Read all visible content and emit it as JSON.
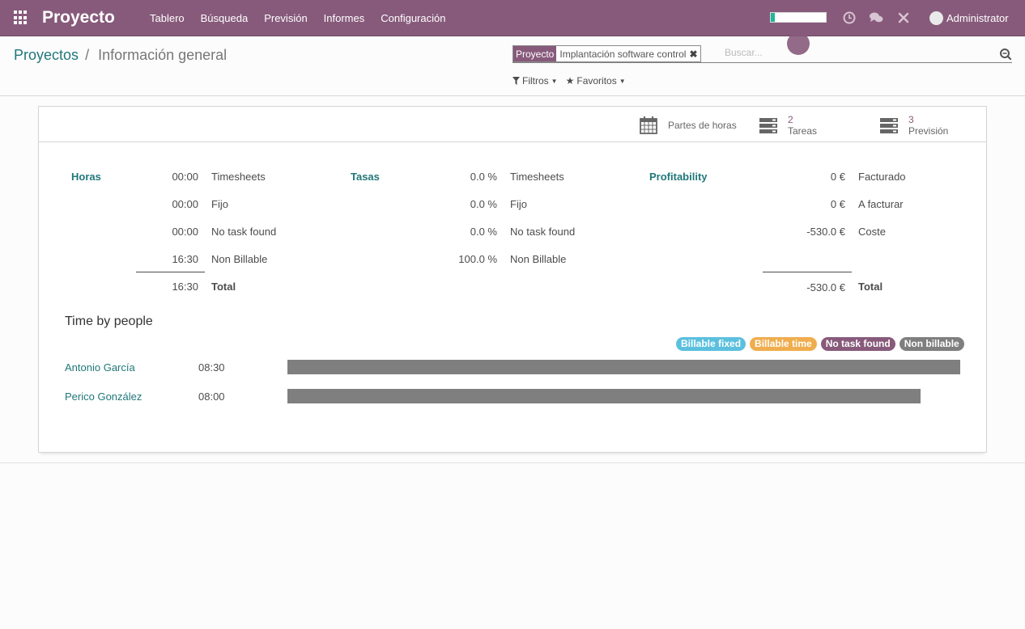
{
  "navbar": {
    "app_title": "Proyecto",
    "menu": [
      "Tablero",
      "Búsqueda",
      "Previsión",
      "Informes",
      "Configuración"
    ],
    "user": "Administrator",
    "progress_fraction": 0.07,
    "icons": [
      "apps-icon",
      "clock-icon",
      "chat-icon",
      "debug-icon",
      "avatar"
    ]
  },
  "breadcrumb": {
    "parent": "Proyectos",
    "separator": "/",
    "current": "Información general"
  },
  "search": {
    "facet_label": "Proyecto",
    "facet_value": "Implantación software control",
    "facet_remove": "✖",
    "placeholder": "Buscar..."
  },
  "filters": {
    "filters_label": "Filtros",
    "favorites_label": "Favoritos"
  },
  "stat_buttons": {
    "timesheets": {
      "label": "Partes de horas"
    },
    "tasks": {
      "value": "2",
      "label": "Tareas"
    },
    "forecast": {
      "value": "3",
      "label": "Previsión"
    }
  },
  "hours": {
    "title": "Horas",
    "rows": [
      {
        "value": "00:00",
        "label": "Timesheets"
      },
      {
        "value": "00:00",
        "label": "Fijo"
      },
      {
        "value": "00:00",
        "label": "No task found"
      },
      {
        "value": "16:30",
        "label": "Non Billable"
      }
    ],
    "total_value": "16:30",
    "total_label": "Total"
  },
  "rates": {
    "title": "Tasas",
    "rows": [
      {
        "value": "0.0 %",
        "label": "Timesheets"
      },
      {
        "value": "0.0 %",
        "label": "Fijo"
      },
      {
        "value": "0.0 %",
        "label": "No task found"
      },
      {
        "value": "100.0 %",
        "label": "Non Billable"
      }
    ]
  },
  "profitability": {
    "title": "Profitability",
    "rows": [
      {
        "value": "0 €",
        "label": "Facturado"
      },
      {
        "value": "0 €",
        "label": "A facturar"
      },
      {
        "value": "-530.0 €",
        "label": "Coste"
      }
    ],
    "total_value": "-530.0 €",
    "total_label": "Total"
  },
  "people": {
    "title": "Time by people",
    "legend": [
      {
        "label": "Billable fixed",
        "color": "#5bc0de"
      },
      {
        "label": "Billable time",
        "color": "#f0ad4e"
      },
      {
        "label": "No task found",
        "color": "#875a7b"
      },
      {
        "label": "Non billable",
        "color": "#7f7f7f"
      }
    ],
    "rows": [
      {
        "name": "Antonio García",
        "hours": "08:30",
        "fraction": 1.0
      },
      {
        "name": "Perico González",
        "hours": "08:00",
        "fraction": 0.941
      }
    ]
  }
}
